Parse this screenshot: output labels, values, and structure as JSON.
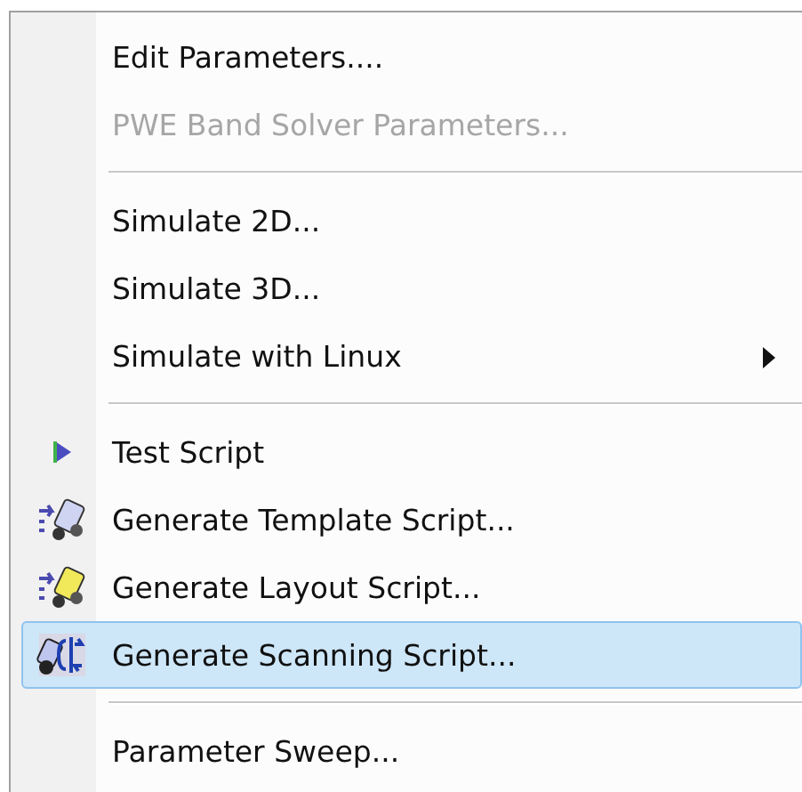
{
  "menu": {
    "items": [
      {
        "kind": "plain",
        "label": "Edit Parameters....",
        "disabled": false,
        "selected": false
      },
      {
        "kind": "plain",
        "label": "PWE Band Solver Parameters...",
        "disabled": true,
        "selected": false
      },
      {
        "kind": "separator"
      },
      {
        "kind": "plain",
        "label": "Simulate 2D...",
        "disabled": false,
        "selected": false
      },
      {
        "kind": "plain",
        "label": "Simulate 3D...",
        "disabled": false,
        "selected": false
      },
      {
        "kind": "plain",
        "label": "Simulate with Linux",
        "disabled": false,
        "selected": false,
        "submenu": true
      },
      {
        "kind": "separator"
      },
      {
        "kind": "run",
        "label": "Test Script",
        "disabled": false,
        "selected": false
      },
      {
        "kind": "template",
        "label": "Generate Template Script...",
        "disabled": false,
        "selected": false
      },
      {
        "kind": "layout",
        "label": "Generate Layout Script...",
        "disabled": false,
        "selected": false
      },
      {
        "kind": "scan",
        "label": "Generate Scanning Script...",
        "disabled": false,
        "selected": true
      },
      {
        "kind": "separator"
      },
      {
        "kind": "plain",
        "label": "Parameter Sweep...",
        "disabled": false,
        "selected": false
      }
    ]
  }
}
